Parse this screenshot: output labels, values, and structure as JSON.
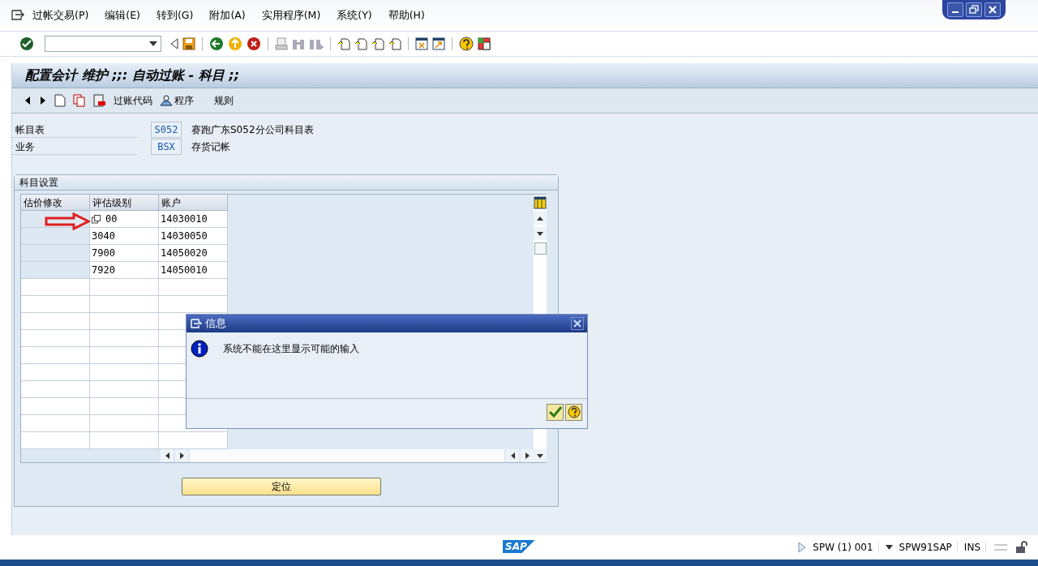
{
  "menu": [
    "过帐交易(P)",
    "编辑(E)",
    "转到(G)",
    "附加(A)",
    "实用程序(M)",
    "系统(Y)",
    "帮助(H)"
  ],
  "screen_title": "配置会计 维护 ;;: 自动过账 - 科目 ;;",
  "app_toolbar": [
    {
      "kind": "icon-text",
      "label": "过账代码"
    },
    {
      "kind": "icon-text",
      "label": "程序"
    },
    {
      "kind": "text",
      "label": "规则"
    }
  ],
  "fields": [
    {
      "label": "帐目表",
      "value": "S052",
      "description": "赛跑广东S052分公司科目表"
    },
    {
      "label": "业务",
      "value": "BSX",
      "description": "存货记帐"
    }
  ],
  "group": {
    "title": "科目设置",
    "table": {
      "columns": [
        "估价修改",
        "评估级别",
        "账户"
      ],
      "rows": [
        [
          "",
          "00",
          "14030010"
        ],
        [
          "",
          "3040",
          "14030050"
        ],
        [
          "",
          "7900",
          "14050020"
        ],
        [
          "",
          "7920",
          "14050010"
        ]
      ]
    },
    "button": "定位"
  },
  "dialog": {
    "title": "信息",
    "message": "系统不能在这里显示可能的输入"
  },
  "status_bar": {
    "system": "SPW (1) 001",
    "server": "SPW91SAP",
    "mode": "INS"
  },
  "logo": "SAP"
}
